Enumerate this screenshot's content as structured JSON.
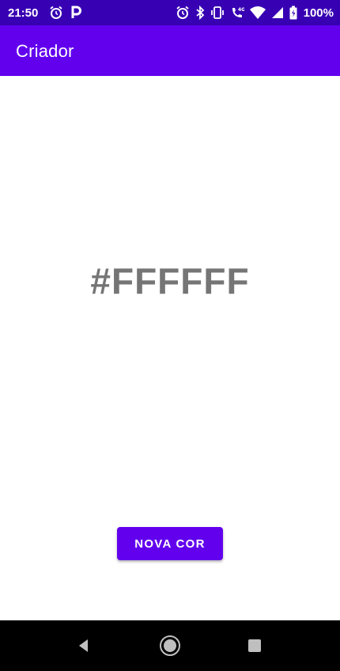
{
  "status_bar": {
    "time": "21:50",
    "battery_percent": "100%",
    "left_icons": [
      "alarm-icon",
      "parking-icon"
    ],
    "right_icons": [
      "alarm-icon",
      "bluetooth-icon",
      "vibrate-icon",
      "lte-call-icon",
      "wifi-icon",
      "signal-icon",
      "battery-icon"
    ],
    "background": "#3700b3"
  },
  "app_bar": {
    "title": "Criador",
    "background": "#6200ee"
  },
  "main": {
    "color_code": "#FFFFFF",
    "text_color": "#757575"
  },
  "action": {
    "button_label": "NOVA COR",
    "button_color": "#6200ee"
  },
  "nav_bar": {
    "buttons": [
      "back-icon",
      "home-icon",
      "recents-icon"
    ]
  }
}
